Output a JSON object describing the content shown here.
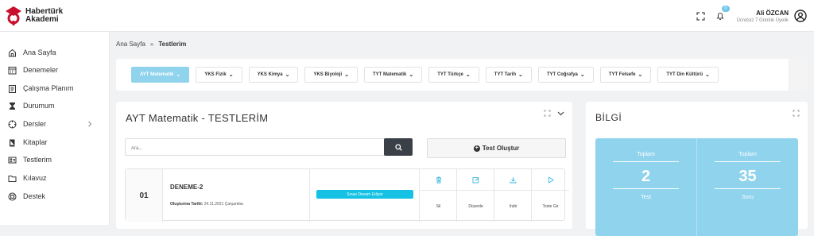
{
  "brand": {
    "line1": "Habertürk",
    "line2": "Akademi",
    "color": "#c8102e"
  },
  "header": {
    "user_name": "Ali ÖZCAN",
    "user_plan": "Ücretsiz 7 Günlük Üyelik",
    "notification_count": "0",
    "icons": [
      "fullscreen-icon",
      "bell-icon",
      "user-avatar-icon"
    ]
  },
  "sidebar": {
    "items": [
      {
        "label": "Ana Sayfa",
        "icon": "home-icon"
      },
      {
        "label": "Denemeler",
        "icon": "calendar-icon"
      },
      {
        "label": "Çalışma Planım",
        "icon": "clipboard-icon"
      },
      {
        "label": "Durumum",
        "icon": "hourglass-icon"
      },
      {
        "label": "Dersler",
        "icon": "compass-icon"
      },
      {
        "label": "Kitaplar",
        "icon": "book-icon"
      },
      {
        "label": "Testlerim",
        "icon": "id-card-icon"
      },
      {
        "label": "Kılavuz",
        "icon": "folder-icon"
      },
      {
        "label": "Destek",
        "icon": "lifebuoy-icon"
      }
    ]
  },
  "breadcrumb": {
    "home": "Ana Sayfa",
    "separator": "»",
    "current": "Testlerim"
  },
  "tabs": [
    {
      "label": "AYT Matematik",
      "active": true
    },
    {
      "label": "YKS Fizik"
    },
    {
      "label": "YKS Kimya"
    },
    {
      "label": "YKS Biyoloji"
    },
    {
      "label": "TYT Matematik"
    },
    {
      "label": "TYT Türkçe"
    },
    {
      "label": "TYT Tarih"
    },
    {
      "label": "TYT Coğrafya"
    },
    {
      "label": "TYT Felsefe"
    },
    {
      "label": "TYT Din Kültürü"
    }
  ],
  "main": {
    "title": "AYT Matematik - TESTLERİM",
    "search_placeholder": "Ara...",
    "create_label": "Test Oluştur",
    "rows": [
      {
        "number": "01",
        "name": "DENEME-2",
        "date_label": "Oluşturma Tarihi:",
        "date_value": "24.11.2021 Çarşamba",
        "status": "Sınav Devam Ediyor",
        "actions": [
          {
            "label": "Sil",
            "icon": "trash-icon"
          },
          {
            "label": "Düzenle",
            "icon": "edit-icon"
          },
          {
            "label": "İndir",
            "icon": "download-icon"
          },
          {
            "label": "Teste Gir",
            "icon": "play-icon"
          }
        ]
      }
    ]
  },
  "info": {
    "title": "BİLGİ",
    "stats": [
      {
        "top": "Toplam",
        "value": "2",
        "bottom": "Test"
      },
      {
        "top": "Toplam",
        "value": "35",
        "bottom": "Soru"
      }
    ]
  },
  "colors": {
    "accent": "#8fd3ed",
    "status": "#15c2e4",
    "dark_button": "#3a3f48"
  }
}
